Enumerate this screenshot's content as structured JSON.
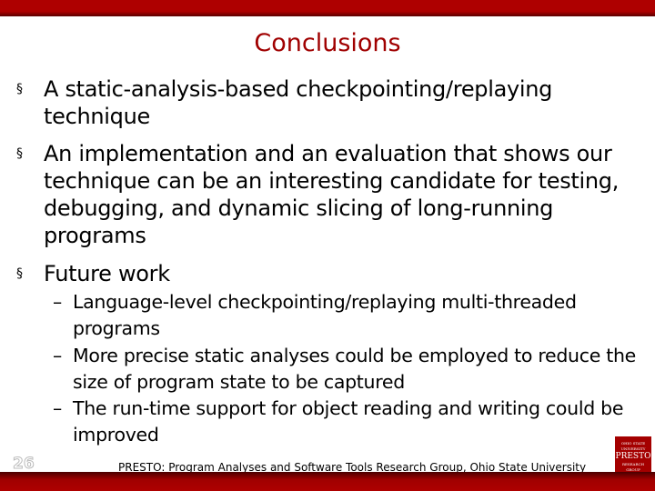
{
  "slide": {
    "title": "Conclusions",
    "bullets": [
      {
        "text": "A static-analysis-based checkpointing/replaying technique"
      },
      {
        "text": "An implementation and an evaluation that shows our technique can be an interesting candidate for testing, debugging, and dynamic slicing of long-running programs"
      },
      {
        "text": "Future work",
        "sub": [
          "Language-level checkpointing/replaying multi-threaded programs",
          "More precise static analyses could be employed to reduce the size of program state to be captured",
          "The run-time support for object reading and writing could be improved"
        ]
      }
    ],
    "bullet_marker": "§",
    "sub_marker": "–",
    "page_number": "26",
    "footer": "PRESTO: Program Analyses and Software Tools Research Group, Ohio State University",
    "logo_text": "OHIO STATE UNIVERSITY PRESTO RESEARCH GROUP",
    "colors": {
      "accent": "#ae0000",
      "title": "#a00000"
    }
  }
}
